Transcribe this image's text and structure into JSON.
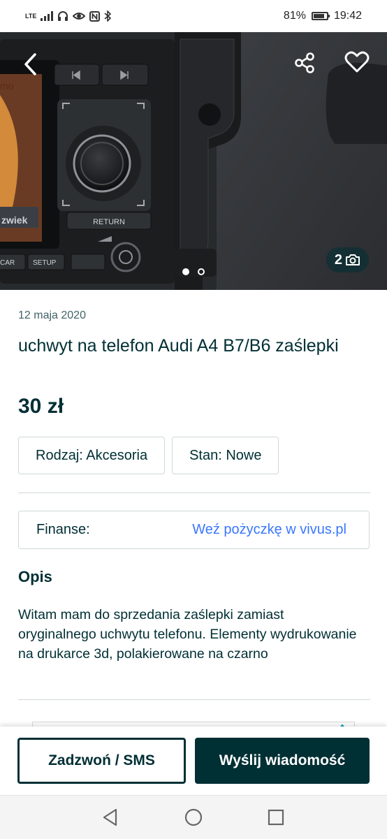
{
  "status_bar": {
    "network": "LTE",
    "battery_percent": "81%",
    "battery_level": 0.81,
    "time": "19:42"
  },
  "gallery": {
    "photo_count": "2",
    "current_index": 1,
    "total": 2,
    "photo_labels": {
      "return": "RETURN",
      "setup": "SETUP",
      "car": "CAR",
      "display_word": "zwiek",
      "display_word_top": "mo"
    }
  },
  "listing": {
    "date": "12 maja 2020",
    "title": "uchwyt na telefon Audi A4 B7/B6 zaślepki",
    "price": "30 zł",
    "tags": [
      "Rodzaj: Akcesoria",
      "Stan: Nowe"
    ],
    "finance_label": "Finanse:",
    "finance_link": "Weź pożyczkę w vivus.pl",
    "description_heading": "Opis",
    "description": "Witam mam do sprzedania zaślepki zamiast oryginalnego uchwytu telefonu. Elementy wydrukowanie na drukarce 3d, polakierowane na czarno"
  },
  "actions": {
    "call_label": "Zadzwoń / SMS",
    "message_label": "Wyślij wiadomość"
  },
  "colors": {
    "primary": "#002f34",
    "link": "#3a77ff",
    "border": "#cfd8d9"
  }
}
